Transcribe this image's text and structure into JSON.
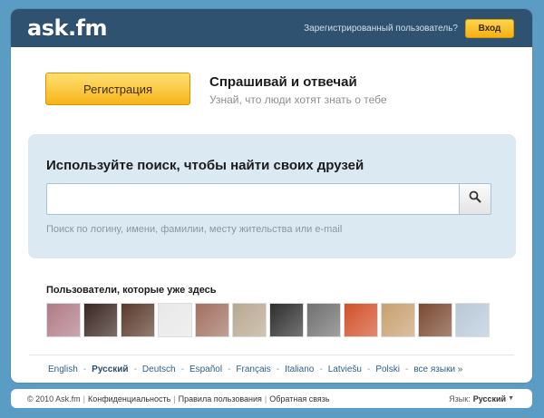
{
  "header": {
    "logo": "ask.fm",
    "registered_text": "Зарегистрированный пользователь?",
    "login_label": "Вход"
  },
  "hero": {
    "register_label": "Регистрация",
    "title": "Спрашивай и отвечай",
    "subtitle": "Узнай, что люди хотят знать о тебе"
  },
  "search": {
    "title": "Используйте поиск, чтобы найти своих друзей",
    "value": "",
    "placeholder": "",
    "hint": "Поиск по логину, имени, фамилии, месту жительства или e-mail",
    "button_icon": "search-icon"
  },
  "users": {
    "title": "Пользователи, которые уже здесь",
    "avatars": [
      {
        "color": "#b07a86"
      },
      {
        "color": "#3a2620"
      },
      {
        "color": "#5a3a2a"
      },
      {
        "color": "#e8e8e8"
      },
      {
        "color": "#a07060"
      },
      {
        "color": "#b8a890"
      },
      {
        "color": "#2e2e2e"
      },
      {
        "color": "#707070"
      },
      {
        "color": "#d2502a"
      },
      {
        "color": "#c8a070"
      },
      {
        "color": "#7a4a30"
      },
      {
        "color": "#b8c8d8"
      }
    ]
  },
  "languages": [
    {
      "label": "English",
      "active": false
    },
    {
      "label": "Русский",
      "active": true
    },
    {
      "label": "Deutsch",
      "active": false
    },
    {
      "label": "Español",
      "active": false
    },
    {
      "label": "Français",
      "active": false
    },
    {
      "label": "Italiano",
      "active": false
    },
    {
      "label": "Latviešu",
      "active": false
    },
    {
      "label": "Polski",
      "active": false
    },
    {
      "label": "все языки »",
      "active": false
    }
  ],
  "footer": {
    "copyright": "© 2010 Ask.fm",
    "links": [
      "Конфиденциальность",
      "Правила пользования",
      "Обратная связь"
    ],
    "lang_label": "Язык:",
    "lang_value": "Русский"
  },
  "colors": {
    "background": "#5b9cc4",
    "header": "#2f5270",
    "accent_yellow": "#f7b41a",
    "search_panel": "#dbe9f3"
  }
}
